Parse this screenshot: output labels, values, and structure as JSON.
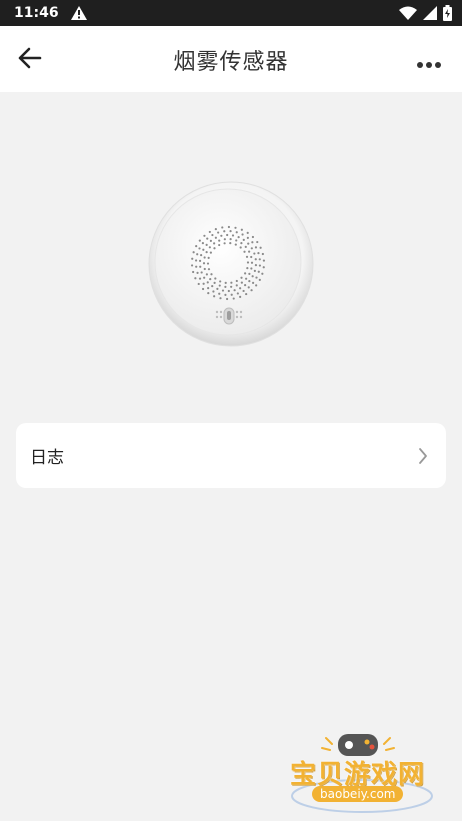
{
  "status_bar": {
    "time": "11:46",
    "icons": [
      "warning-icon",
      "wifi-icon",
      "signal-icon",
      "battery-charging-icon"
    ]
  },
  "header": {
    "title": "烟雾传感器",
    "back_icon": "arrow-left-icon",
    "more_icon": "more-horizontal-icon"
  },
  "device": {
    "image": "smoke-sensor-device"
  },
  "log_item": {
    "label": "日志",
    "chevron_icon": "chevron-right-icon"
  },
  "watermark": {
    "text": "宝贝游戏网",
    "url": "baobeiy.com"
  },
  "colors": {
    "background": "#f2f2f2",
    "statusbar": "#1f1f1f",
    "watermark_accent": "#f2b233"
  }
}
